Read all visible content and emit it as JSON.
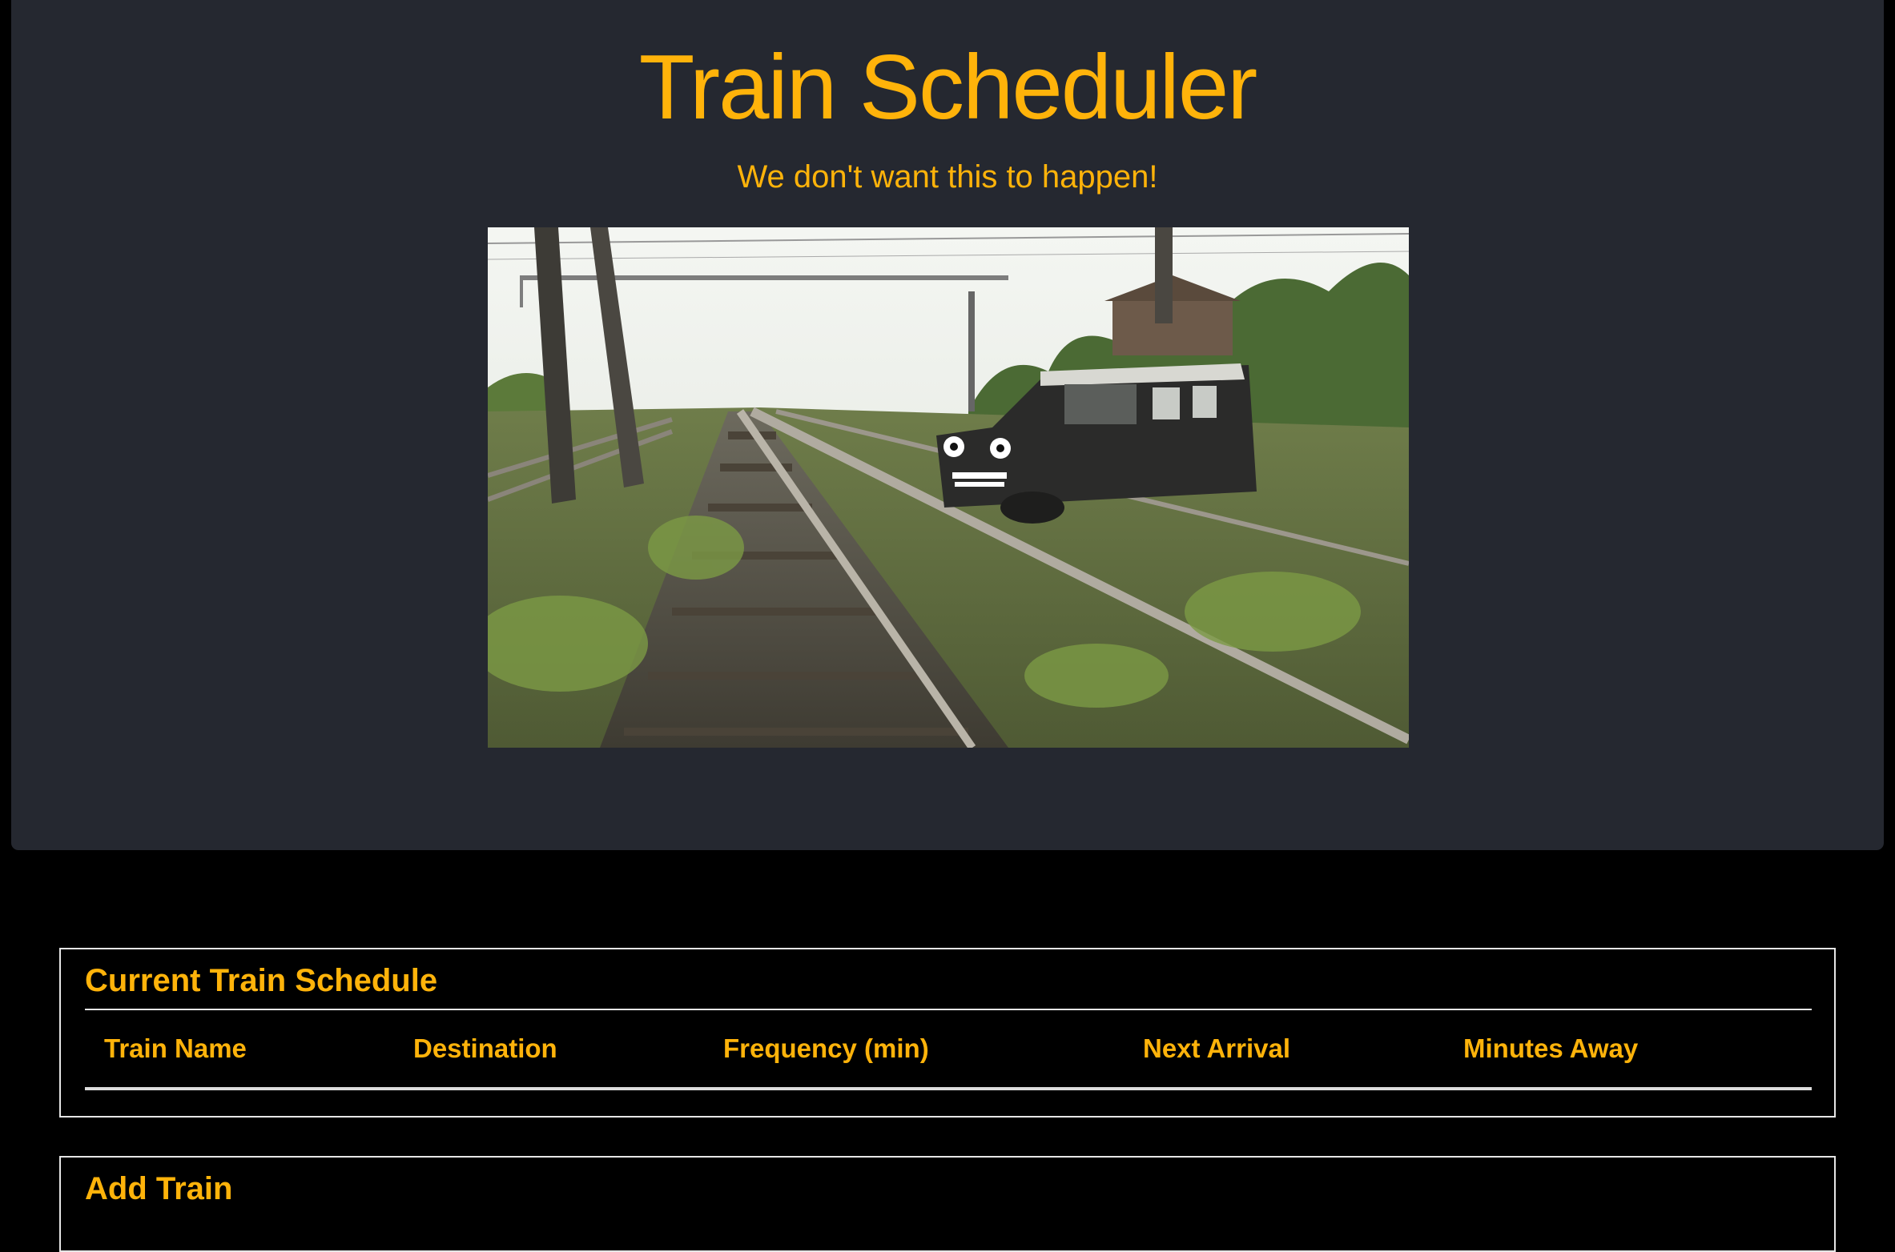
{
  "header": {
    "title": "Train Scheduler",
    "subtitle": "We don't want this to happen!",
    "background_color": "#252830",
    "accent_color": "#FFB30A"
  },
  "hero_image": {
    "alt": "Car with cartoon face driving across railway tracks"
  },
  "schedule": {
    "heading": "Current Train Schedule",
    "columns": [
      "Train Name",
      "Destination",
      "Frequency (min)",
      "Next Arrival",
      "Minutes Away"
    ],
    "rows": []
  },
  "add_train": {
    "heading": "Add Train"
  }
}
